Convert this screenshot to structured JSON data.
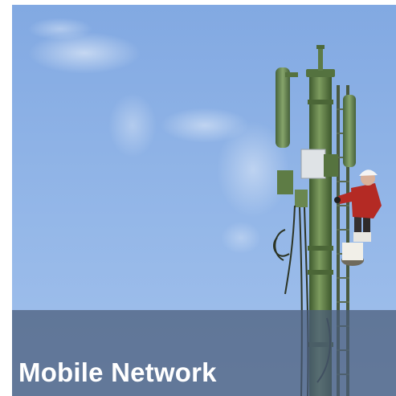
{
  "tile": {
    "caption": "Mobile Network"
  },
  "image": {
    "subject": "cell-tower-with-climber-icon"
  },
  "colors": {
    "sky": "#8fb3e6",
    "tower": "#5f7f45",
    "caption_band": "#4a5c78",
    "caption_text": "#ffffff"
  }
}
